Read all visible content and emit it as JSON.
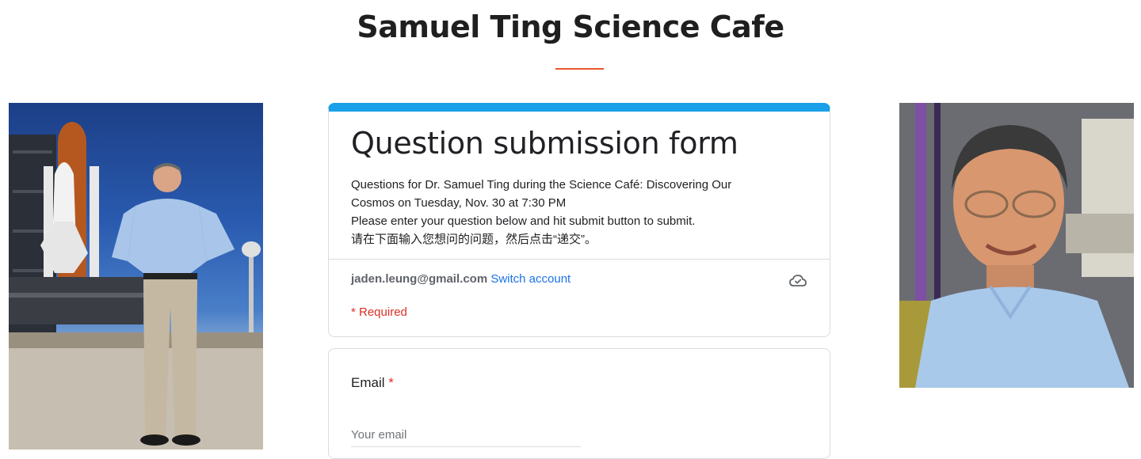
{
  "page": {
    "title": "Samuel Ting Science Cafe"
  },
  "form": {
    "title": "Question submission form",
    "description_lines": [
      "Questions for Dr. Samuel Ting during the Science Café: Discovering Our",
      "Cosmos on Tuesday, Nov. 30 at 7:30 PM",
      "Please enter your question below and hit submit button to submit.",
      "请在下面输入您想问的问题，然后点击“递交”。"
    ],
    "account_email": "jaden.leung@gmail.com",
    "switch_account_label": "Switch account",
    "required_note": "* Required",
    "accent_color": "#1aa0e8"
  },
  "question": {
    "label": "Email",
    "asterisk": "*",
    "placeholder": "Your email"
  },
  "icons": {
    "cloud": "cloud-check-icon"
  }
}
